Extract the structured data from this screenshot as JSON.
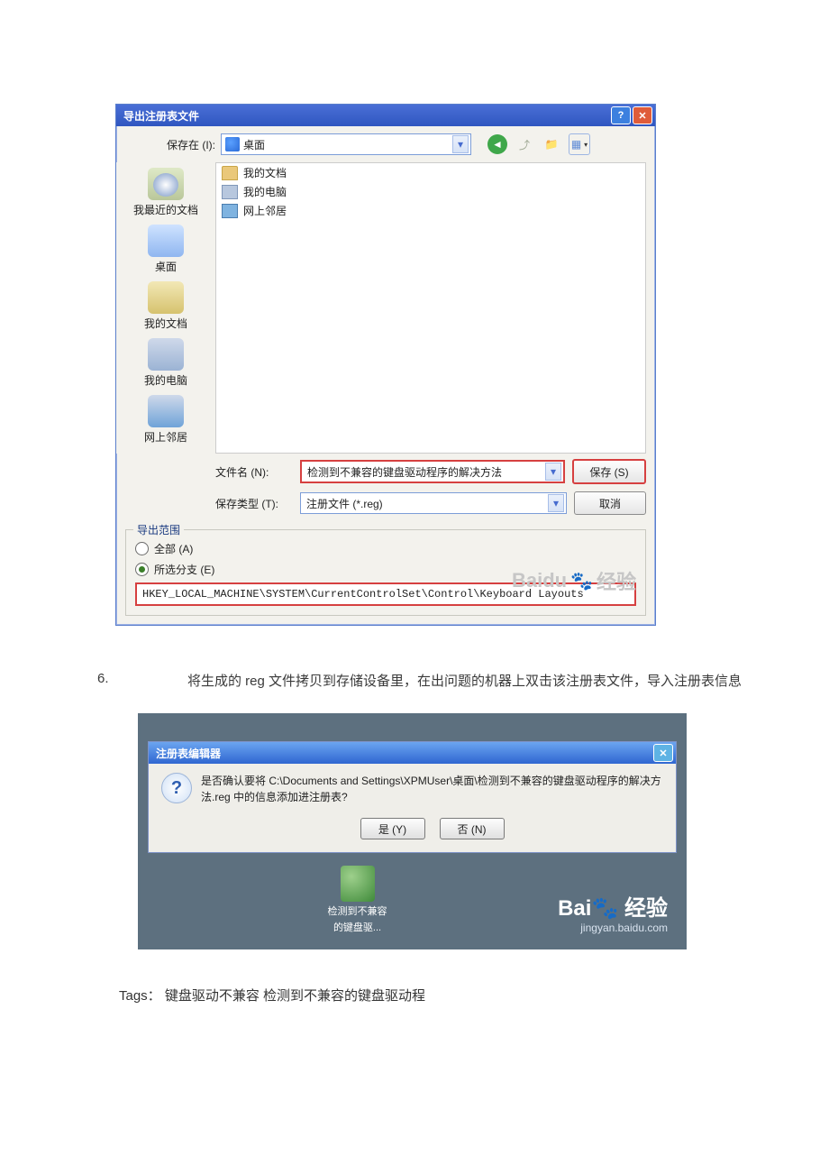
{
  "save_dialog": {
    "title": "导出注册表文件",
    "location_label": "保存在 (I):",
    "location_value": "桌面",
    "file_list": [
      "我的文档",
      "我的电脑",
      "网上邻居"
    ],
    "places_bar": [
      "我最近的文档",
      "桌面",
      "我的文档",
      "我的电脑",
      "网上邻居"
    ],
    "filename_label": "文件名 (N):",
    "filename_value": "检测到不兼容的键盘驱动程序的解决方法",
    "filetype_label": "保存类型 (T):",
    "filetype_value": "注册文件 (*.reg)",
    "save_btn": "保存 (S)",
    "cancel_btn": "取消",
    "export_range": {
      "legend": "导出范围",
      "all": "全部 (A)",
      "branch": "所选分支 (E)",
      "path": "HKEY_LOCAL_MACHINE\\SYSTEM\\CurrentControlSet\\Control\\Keyboard Layouts"
    },
    "watermark": "经验",
    "watermark_brand": "Baidu"
  },
  "step": {
    "number": "6.",
    "text": "将生成的 reg 文件拷贝到存储设备里，在出问题的机器上双击该注册表文件，导入注册表信息"
  },
  "confirm_dialog": {
    "title": "注册表编辑器",
    "message": "是否确认要将 C:\\Documents and Settings\\XPMUser\\桌面\\检测到不兼容的键盘驱动程序的解决方法.reg 中的信息添加进注册表?",
    "yes": "是 (Y)",
    "no": "否 (N)",
    "reg_file_label_line1": "检测到不兼容",
    "reg_file_label_line2": "的键盘驱...",
    "watermark_big": "Baidu 经验",
    "watermark_sub": "jingyan.baidu.com"
  },
  "tags": {
    "label": "Tags：",
    "t1": "键盘驱动不兼容",
    "t2": "检测到不兼容的键盘驱动程"
  }
}
